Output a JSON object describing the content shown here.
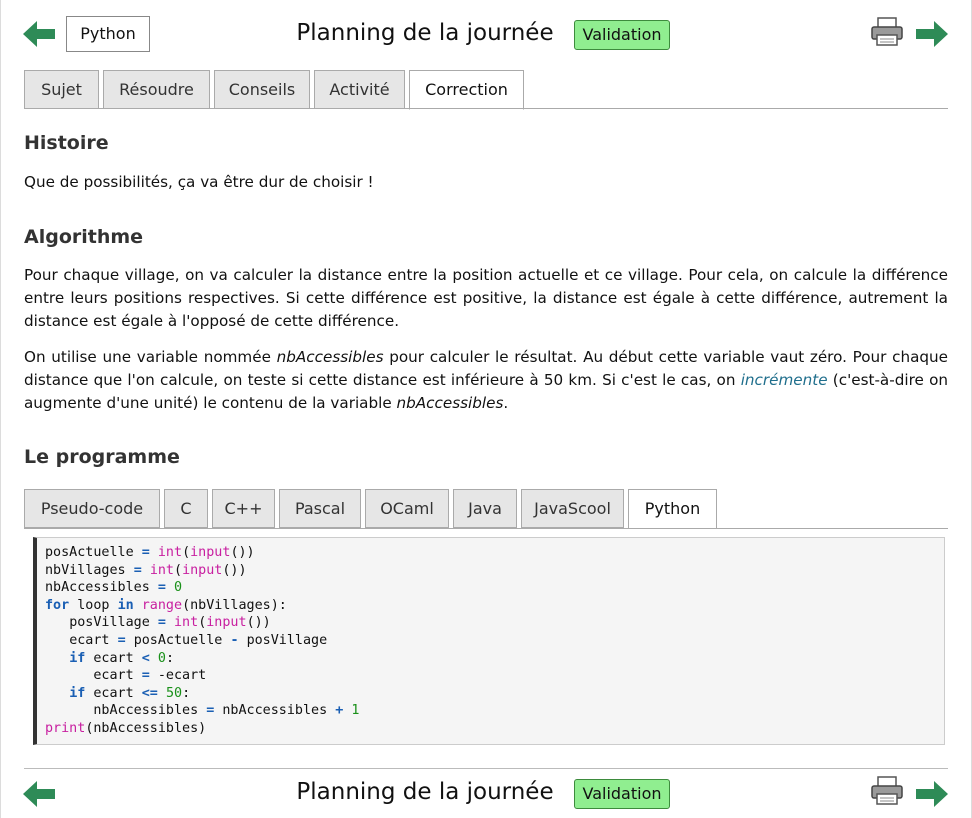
{
  "header": {
    "language_button": "Python",
    "title": "Planning de la journée",
    "validation_label": "Validation"
  },
  "main_tabs": [
    {
      "label": "Sujet",
      "active": false
    },
    {
      "label": "Résoudre",
      "active": false
    },
    {
      "label": "Conseils",
      "active": false
    },
    {
      "label": "Activité",
      "active": false
    },
    {
      "label": "Correction",
      "active": true
    }
  ],
  "sections": {
    "histoire": {
      "title": "Histoire",
      "text": "Que de possibilités, ça va être dur de choisir !"
    },
    "algorithme": {
      "title": "Algorithme",
      "p1": "Pour chaque village, on va calculer la distance entre la position actuelle et ce village. Pour cela, on calcule la différence entre leurs positions respectives. Si cette différence est positive, la distance est égale à cette différence, autrement la distance est égale à l'opposé de cette différence.",
      "p2_a": "On utilise une variable nommée ",
      "p2_var": "nbAccessibles",
      "p2_b": " pour calculer le résultat. Au début cette variable vaut zéro. Pour chaque distance que l'on calcule, on teste si cette distance est inférieure à 50 km. Si c'est le cas, on ",
      "p2_link": "incrémente",
      "p2_c": " (c'est-à-dire on augmente d'une unité) le contenu de la variable ",
      "p2_var2": "nbAccessibles",
      "p2_d": "."
    },
    "programme": {
      "title": "Le programme"
    }
  },
  "code_tabs": [
    {
      "label": "Pseudo-code",
      "active": false
    },
    {
      "label": "C",
      "active": false
    },
    {
      "label": "C++",
      "active": false
    },
    {
      "label": "Pascal",
      "active": false
    },
    {
      "label": "OCaml",
      "active": false
    },
    {
      "label": "Java",
      "active": false
    },
    {
      "label": "JavaScool",
      "active": false
    },
    {
      "label": "Python",
      "active": true
    }
  ],
  "code": {
    "t": [
      "posActuelle",
      "=",
      "int",
      "(",
      "input",
      "())",
      "nbVillages",
      "nbAccessibles",
      "0",
      "for",
      "loop",
      "in",
      "range",
      "(nbVillages):",
      "posVillage",
      "ecart",
      "posActuelle",
      "-",
      "posVillage",
      "if",
      "ecart",
      "<",
      "0",
      ":",
      "-ecart",
      "<=",
      "50",
      "+",
      "1",
      "print",
      "(nbAccessibles)"
    ]
  },
  "footer": {
    "title": "Planning de la journée",
    "validation_label": "Validation"
  },
  "colors": {
    "arrow": "#2e8b57",
    "validation_bg": "#90ee90",
    "link": "#1f6e8c"
  }
}
